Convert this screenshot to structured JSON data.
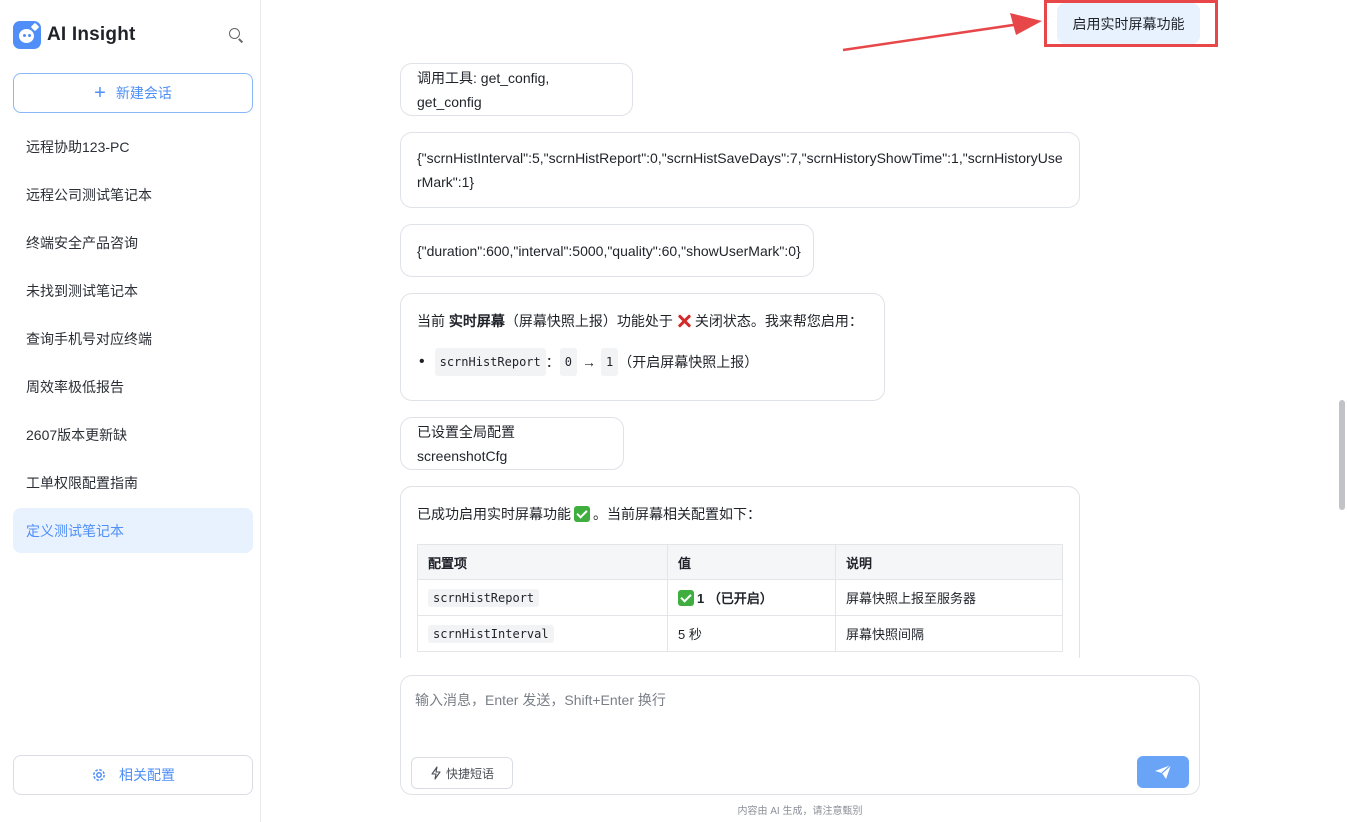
{
  "app": {
    "title": "AI Insight"
  },
  "sidebar": {
    "new_chat_label": "新建会话",
    "items": [
      {
        "label": "远程协助123-PC"
      },
      {
        "label": "远程公司测试笔记本"
      },
      {
        "label": "终端安全产品咨询"
      },
      {
        "label": "未找到测试笔记本"
      },
      {
        "label": "查询手机号对应终端"
      },
      {
        "label": "周效率极低报告"
      },
      {
        "label": "2607版本更新缺"
      },
      {
        "label": "工单权限配置指南"
      },
      {
        "label": "定义测试笔记本"
      }
    ],
    "active_index": 8,
    "settings_label": "相关配置"
  },
  "conversation": {
    "user_message": "启用实时屏幕功能",
    "tool_call": "调用工具: get_config, get_config",
    "config_json_1": "{\"scrnHistInterval\":5,\"scrnHistReport\":0,\"scrnHistSaveDays\":7,\"scrnHistoryShowTime\":1,\"scrnHistoryUserMark\":1}",
    "config_json_2": "{\"duration\":600,\"interval\":5000,\"quality\":60,\"showUserMark\":0}",
    "status_msg": {
      "prefix": "当前 ",
      "bold": "实时屏幕",
      "mid": "（屏幕快照上报）功能处于",
      "suffix": "关闭状态。我来帮您启用：",
      "bullet_key": "scrnHistReport",
      "bullet_sep": "：",
      "bullet_from": "0",
      "bullet_arrow": "→",
      "bullet_to": "1",
      "bullet_note": "（开启屏幕快照上报）"
    },
    "set_global": "已设置全局配置 screenshotCfg",
    "success_msg": {
      "text": "已成功启用实时屏幕功能",
      "suffix": "。当前屏幕相关配置如下："
    },
    "table": {
      "headers": [
        "配置项",
        "值",
        "说明"
      ],
      "rows": [
        {
          "key": "scrnHistReport",
          "value": "1 （已开启）",
          "desc": "屏幕快照上报至服务器"
        },
        {
          "key": "scrnHistInterval",
          "value": "5 秒",
          "desc": "屏幕快照间隔"
        }
      ]
    }
  },
  "composer": {
    "placeholder": "输入消息，Enter 发送，Shift+Enter 换行",
    "quick_phrases_label": "快捷短语",
    "footnote": "内容由 AI 生成，请注意甄别"
  },
  "colors": {
    "accent": "#4f8ff7",
    "highlight": "#e8474a",
    "active_bg": "#e8f1fe"
  }
}
